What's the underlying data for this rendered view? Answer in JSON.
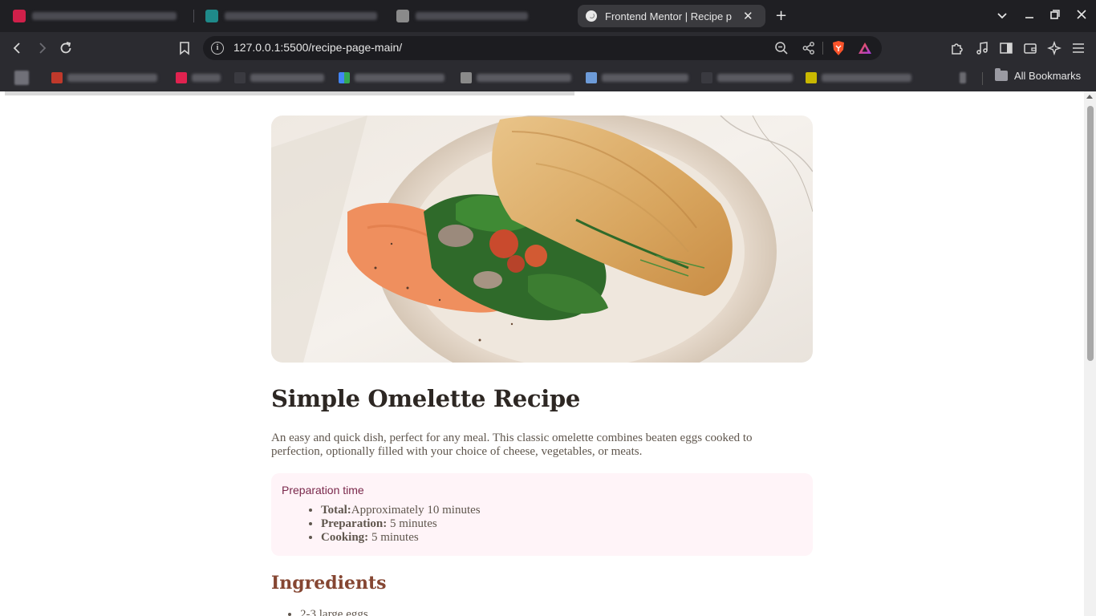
{
  "browser": {
    "active_tab_title": "Frontend Mentor | Recipe p",
    "new_tab_label": "+",
    "url": "127.0.0.1:5500/recipe-page-main/",
    "all_bookmarks_label": "All Bookmarks",
    "icons": [
      "back-icon",
      "forward-icon",
      "reload-icon",
      "bookmark-icon",
      "info-icon",
      "zoom-out-icon",
      "share-icon",
      "brave-shield-icon",
      "brave-rewards-icon",
      "extensions-icon",
      "media-icon",
      "sidebar-icon",
      "wallet-icon",
      "leo-ai-icon",
      "menu-icon"
    ],
    "colors": {
      "tab_strip": "#1f1f23",
      "toolbar": "#2b2b30",
      "accent_brave": "#fb542b"
    }
  },
  "recipe": {
    "title": "Simple Omelette Recipe",
    "description": "An easy and quick dish, perfect for any meal. This classic omelette combines beaten eggs cooked to perfection, optionally filled with your choice of cheese, vegetables, or meats.",
    "prep": {
      "heading": "Preparation time",
      "items": [
        {
          "label": "Total:",
          "value": "Approximately 10 minutes"
        },
        {
          "label": "Preparation:",
          "value": " 5 minutes"
        },
        {
          "label": "Cooking:",
          "value": " 5 minutes"
        }
      ]
    },
    "ingredients_heading": "Ingredients",
    "ingredients": [
      "2-3 large eggs"
    ],
    "colors": {
      "title": "#2d2723",
      "accent": "#854632",
      "prep_bg": "#fff4f8",
      "prep_heading": "#7a284b"
    }
  }
}
